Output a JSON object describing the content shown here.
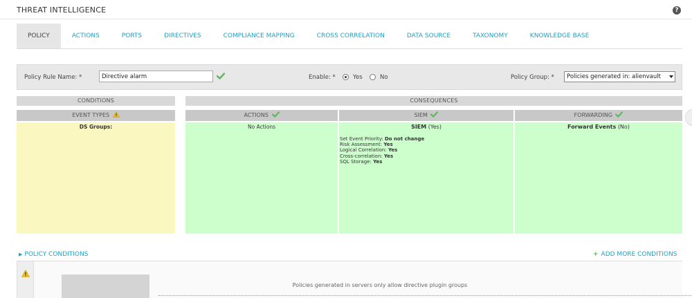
{
  "header": {
    "title": "THREAT INTELLIGENCE",
    "help_icon": "question-circle-icon"
  },
  "tabs": [
    {
      "label": "POLICY",
      "active": true
    },
    {
      "label": "ACTIONS"
    },
    {
      "label": "PORTS"
    },
    {
      "label": "DIRECTIVES"
    },
    {
      "label": "COMPLIANCE MAPPING"
    },
    {
      "label": "CROSS CORRELATION"
    },
    {
      "label": "DATA SOURCE"
    },
    {
      "label": "TAXONOMY"
    },
    {
      "label": "KNOWLEDGE BASE"
    }
  ],
  "form": {
    "rule_name_label": "Policy Rule Name: *",
    "rule_name_value": "Directive alarm",
    "enable_label": "Enable: *",
    "enable_yes": "Yes",
    "enable_no": "No",
    "enable_selected": "Yes",
    "group_label": "Policy Group: *",
    "group_value": "Policies generated in: alienvault"
  },
  "conditions": {
    "header": "CONDITIONS",
    "event_types_label": "EVENT TYPES",
    "ds_groups_label": "DS Groups:"
  },
  "consequences": {
    "header": "CONSEQUENCES",
    "actions_label": "ACTIONS",
    "actions_value": "No Actions",
    "siem_label": "SIEM",
    "siem_title": "SIEM",
    "siem_status": "(Yes)",
    "siem_details": [
      {
        "label": "Set Event Priority:",
        "value": "Do not change"
      },
      {
        "label": "Risk Assessment:",
        "value": "Yes"
      },
      {
        "label": "Logical Correlation:",
        "value": "Yes"
      },
      {
        "label": "Cross-correlation:",
        "value": "Yes"
      },
      {
        "label": "SQL Storage:",
        "value": "Yes"
      }
    ],
    "forwarding_label": "FORWARDING",
    "forwarding_title": "Forward Events",
    "forwarding_status": "(No)"
  },
  "policy_conditions": {
    "toggle_label": "POLICY CONDITIONS",
    "add_label": "ADD MORE CONDITIONS",
    "message": "Policies generated in servers only allow directive plugin groups"
  },
  "colors": {
    "accent": "#1fa1c4",
    "check_green": "#5cb85c",
    "warning_yellow": "#f0c020",
    "conditions_bg": "#faf8c0",
    "consequences_bg": "#ccffcc"
  }
}
